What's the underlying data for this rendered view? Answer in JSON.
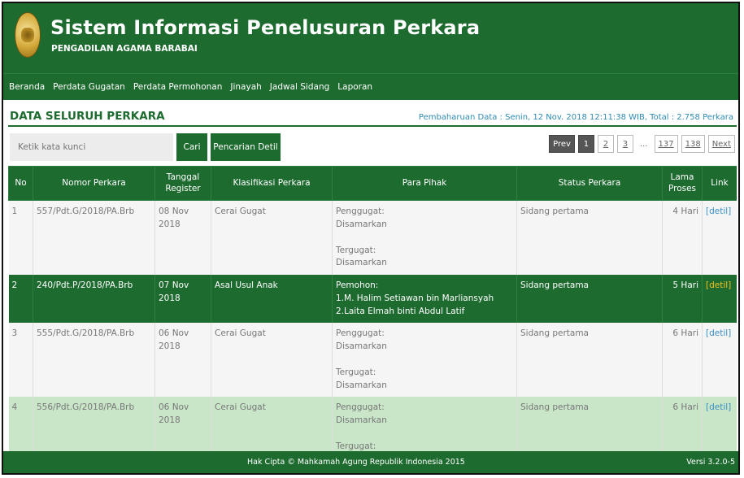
{
  "header": {
    "title": "Sistem Informasi Penelusuran Perkara",
    "subtitle": "PENGADILAN AGAMA BARABAI"
  },
  "nav": [
    "Beranda",
    "Perdata Gugatan",
    "Perdata Permohonan",
    "Jinayah",
    "Jadwal Sidang",
    "Laporan"
  ],
  "main": {
    "section_title": "DATA SELURUH PERKARA",
    "update_info": "Pembaharuan Data : Senin, 12 Nov. 2018 12:11:38 WIB, Total : 2.758 Perkara",
    "search_placeholder": "Ketik kata kunci",
    "search_button": "Cari",
    "advanced_button": "Pencarian Detil"
  },
  "pagination": {
    "prev": "Prev",
    "current": "1",
    "pages": [
      "2",
      "3"
    ],
    "ellipsis": "...",
    "last_pages": [
      "137",
      "138"
    ],
    "next": "Next"
  },
  "table": {
    "headers": [
      "No",
      "Nomor Perkara",
      "Tanggal Register",
      "Klasifikasi Perkara",
      "Para Pihak",
      "Status Perkara",
      "Lama Proses",
      "Link"
    ],
    "rows": [
      {
        "no": "1",
        "nomor": "557/Pdt.G/2018/PA.Brb",
        "tanggal": "08 Nov 2018",
        "klasifikasi": "Cerai Gugat",
        "pihak_1_label": "Penggugat:",
        "pihak_1_value": "Disamarkan",
        "pihak_2_label": "Tergugat:",
        "pihak_2_value": "Disamarkan",
        "status": "Sidang pertama",
        "lama": "4 Hari",
        "link": "[detil]"
      },
      {
        "no": "2",
        "nomor": "240/Pdt.P/2018/PA.Brb",
        "tanggal": "07 Nov 2018",
        "klasifikasi": "Asal Usul Anak",
        "pihak_1_label": "Pemohon:",
        "pihak_1_value": "1.M. Halim Setiawan bin Marliansyah",
        "pihak_1_value_2": "2.Laita Elmah binti Abdul Latif",
        "status": "Sidang pertama",
        "lama": "5 Hari",
        "link": "[detil]"
      },
      {
        "no": "3",
        "nomor": "555/Pdt.G/2018/PA.Brb",
        "tanggal": "06 Nov 2018",
        "klasifikasi": "Cerai Gugat",
        "pihak_1_label": "Penggugat:",
        "pihak_1_value": "Disamarkan",
        "pihak_2_label": "Tergugat:",
        "pihak_2_value": "Disamarkan",
        "status": "Sidang pertama",
        "lama": "6 Hari",
        "link": "[detil]"
      },
      {
        "no": "4",
        "nomor": "556/Pdt.G/2018/PA.Brb",
        "tanggal": "06 Nov 2018",
        "klasifikasi": "Cerai Gugat",
        "pihak_1_label": "Penggugat:",
        "pihak_1_value": "Disamarkan",
        "pihak_2_label": "Tergugat:",
        "status": "Sidang pertama",
        "lama": "6 Hari",
        "link": "[detil]"
      }
    ]
  },
  "footer": {
    "copyright": "Hak Cipta © Mahkamah Agung Republik Indonesia 2015",
    "version": "Versi 3.2.0-5"
  },
  "colors": {
    "primary_green": "#1e6b30",
    "highlight_row": "#c9e6c9",
    "link_blue": "#3a8fc3",
    "selected_link": "#f0c020"
  }
}
